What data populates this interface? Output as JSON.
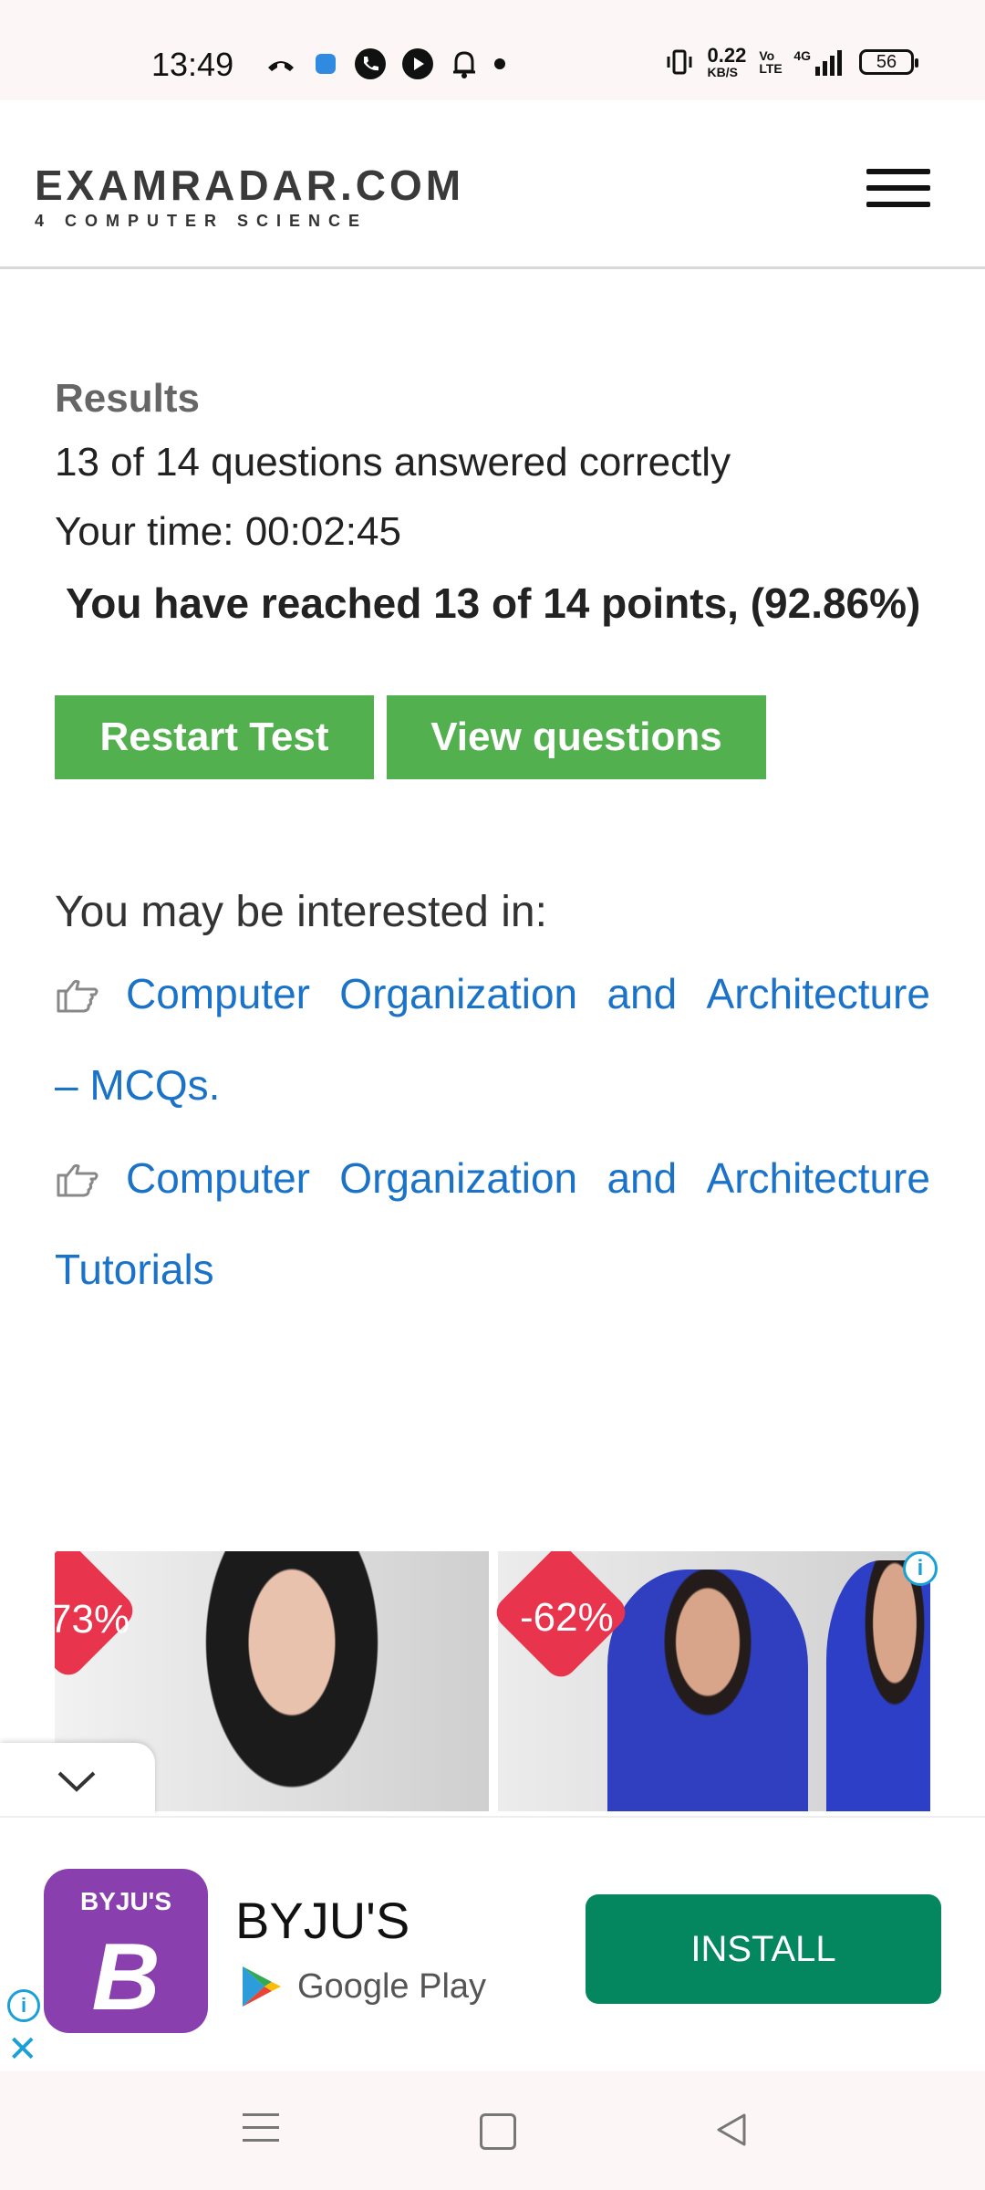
{
  "status_bar": {
    "time": "13:49",
    "network_speed": "0.22",
    "network_unit": "KB/S",
    "volte": "Vo LTE",
    "network_type": "4G",
    "battery": "56"
  },
  "header": {
    "logo_main": "EXAMRADAR.COM",
    "logo_sub": "4 COMPUTER SCIENCE"
  },
  "results": {
    "title": "Results",
    "correct_line": "13 of 14 questions answered correctly",
    "time_line": "Your time: 00:02:45",
    "points_line": "You have reached 13 of 14 points, (92.86%)"
  },
  "buttons": {
    "restart": "Restart Test",
    "view": "View questions"
  },
  "interested": {
    "heading": "You may be interested in:",
    "links": [
      {
        "words": [
          "Computer",
          "Organization",
          "and",
          "Architecture"
        ],
        "continuation": "– MCQs."
      },
      {
        "words": [
          "Computer",
          "Organization",
          "and",
          "Architecture"
        ],
        "continuation": "Tutorials"
      }
    ]
  },
  "ad_images": {
    "discount_1": "73%",
    "discount_2": "-62%"
  },
  "bottom_ad": {
    "icon_brand": "BYJU'S",
    "icon_letter": "B",
    "app_name": "BYJU'S",
    "store": "Google Play",
    "install_label": "INSTALL"
  },
  "colors": {
    "accent_green": "#53b04f",
    "link_blue": "#1a73c9",
    "install_green": "#04865e",
    "app_purple": "#8a3fae"
  }
}
